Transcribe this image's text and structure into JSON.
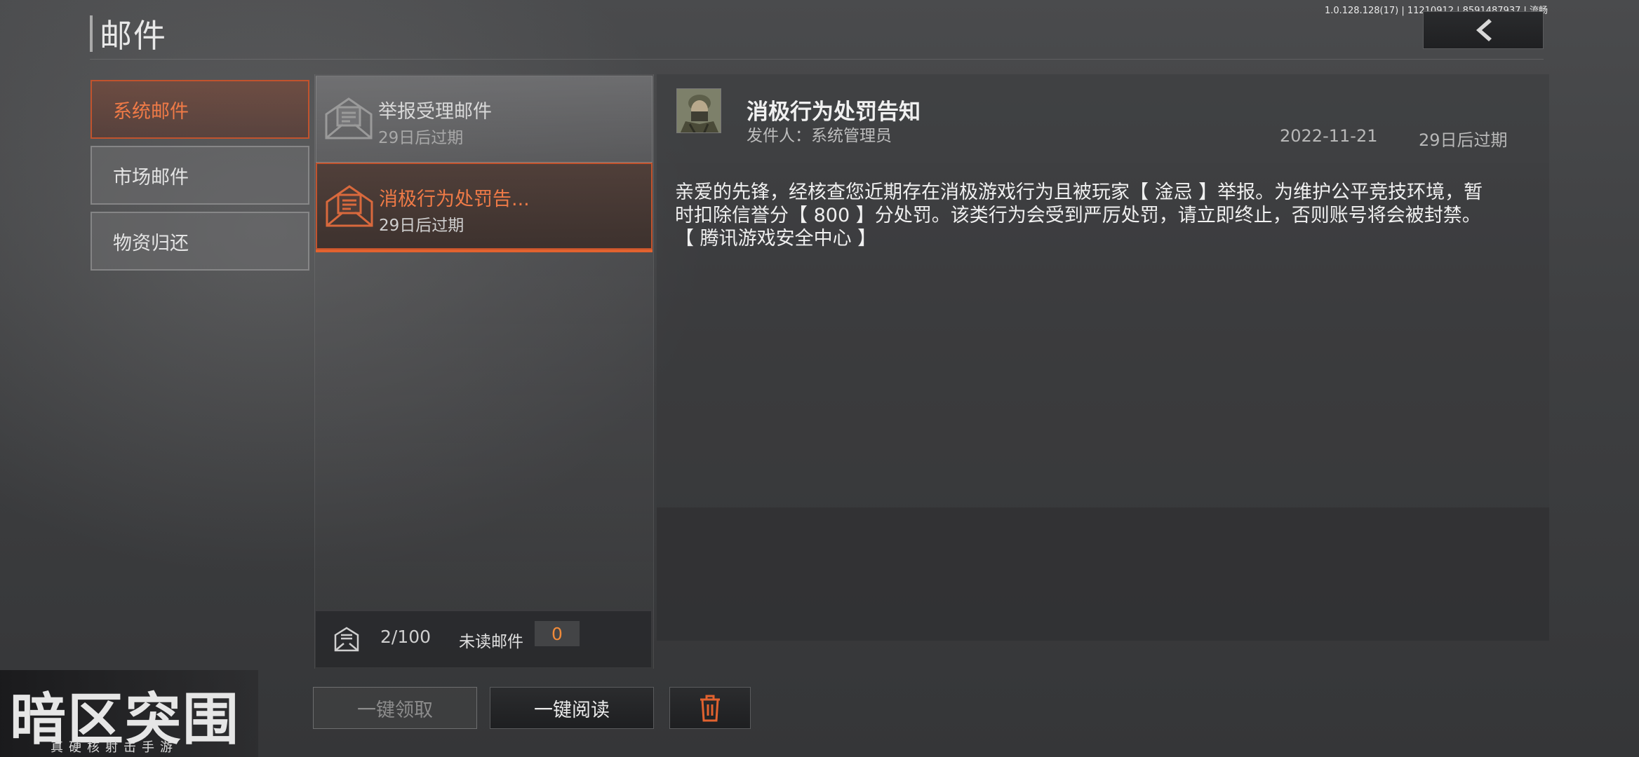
{
  "header": {
    "title": "邮件",
    "version": "1.0.128.128(17) | 11210912 | 8591487937 | 流畅"
  },
  "categories": [
    {
      "label": "系统邮件",
      "active": true
    },
    {
      "label": "市场邮件",
      "active": false
    },
    {
      "label": "物资归还",
      "active": false
    }
  ],
  "mail_list": [
    {
      "title": "举报受理邮件",
      "expiry": "29日后过期",
      "active": false
    },
    {
      "title": "消极行为处罚告...",
      "expiry": "29日后过期",
      "active": true
    }
  ],
  "footer": {
    "count": "2/100",
    "unread_label": "未读邮件",
    "unread_value": "0"
  },
  "buttons": {
    "claim_all": "一键领取",
    "read_all": "一键阅读"
  },
  "detail": {
    "title": "消极行为处罚告知",
    "sender": "发件人：系统管理员",
    "date": "2022-11-21",
    "expiry": "29日后过期",
    "body_line1": "亲爱的先锋，经核查您近期存在消极游戏行为且被玩家【 淦忌 】举报。为维护公平竞技环境，暂",
    "body_line2": "时扣除信誉分【 800 】分处罚。该类行为会受到严厉处罚，请立即终止，否则账号将会被封禁。",
    "body_line3": "【 腾讯游戏安全中心 】"
  },
  "logo": {
    "main": "暗区突围",
    "sub": "真硬核射击手游"
  },
  "colors": {
    "accent": "#ef7a47",
    "accent_border": "#c2532d",
    "unread": "#ef8a3a",
    "trash": "#e2622f"
  }
}
